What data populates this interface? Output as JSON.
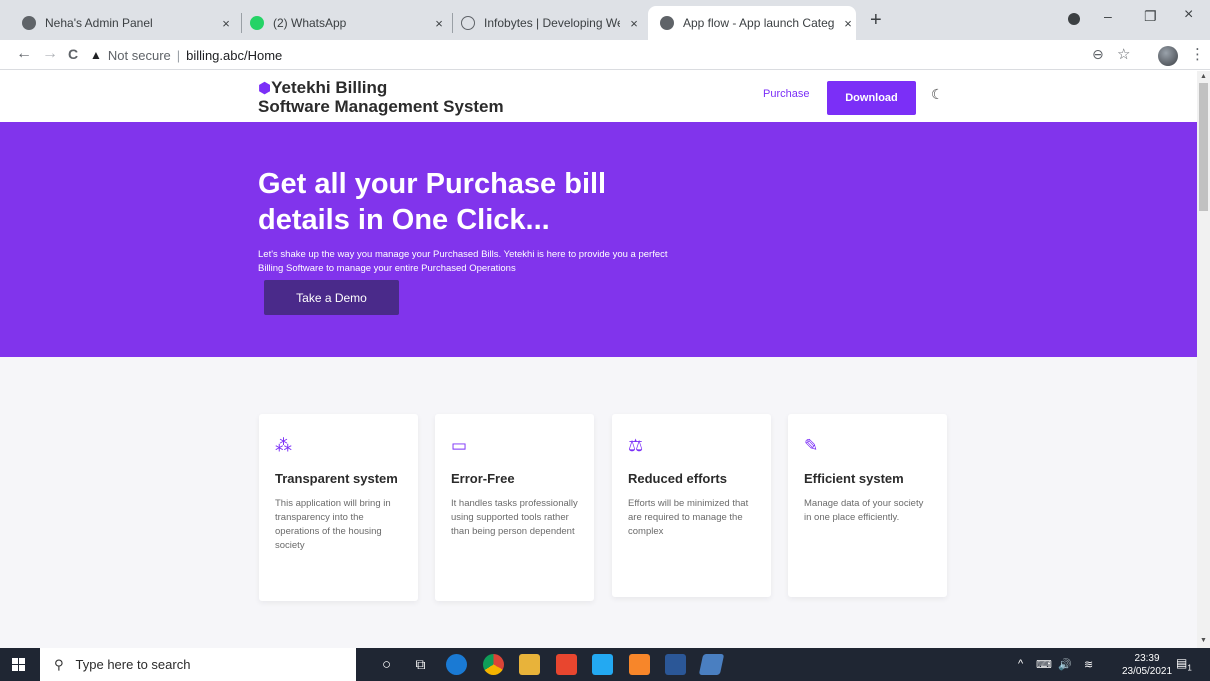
{
  "browser": {
    "tabs": [
      {
        "title": "Neha's Admin Panel",
        "close": "×"
      },
      {
        "title": "(2) WhatsApp",
        "close": "×"
      },
      {
        "title": "Infobytes | Developing Websites",
        "close": "×"
      },
      {
        "title": "App flow - App launch Category",
        "close": "×"
      }
    ],
    "new_tab": "+",
    "window": {
      "minimize": "–",
      "restore": "❐",
      "close": "×"
    },
    "nav": {
      "back": "←",
      "forward": "→",
      "reload": "C"
    },
    "address": {
      "warning_icon": "▲",
      "security": "Not secure",
      "divider": "|",
      "url": "billing.abc/Home"
    },
    "icons": {
      "zoom": "⊖",
      "star": "☆",
      "menu": "⋮"
    }
  },
  "site": {
    "brand_line1": "Yetekhi Billing",
    "brand_line2": "Software Management System",
    "brand_icon": "⬢",
    "nav_link": "Purchase",
    "download": "Download",
    "theme_icon": "☾",
    "accent": "#7b2ff7"
  },
  "hero": {
    "title": "Get all your Purchase bill details in One Click...",
    "text": "Let's shake up the way you manage your Purchased Bills. Yetekhi is here to provide you a perfect Billing Software to manage your entire Purchased Operations",
    "cta": "Take a Demo",
    "background": "#8134ec"
  },
  "features": [
    {
      "icon": "cubes-icon",
      "glyph": "⁂",
      "title": "Transparent system",
      "text": "This application will bring in transparency into the operations of the housing society"
    },
    {
      "icon": "laptop-icon",
      "glyph": "▭",
      "title": "Error-Free",
      "text": "It handles tasks professionally using supported tools rather than being person dependent"
    },
    {
      "icon": "balance-scale-icon",
      "glyph": "⚖",
      "title": "Reduced efforts",
      "text": "Efforts will be minimized that are required to manage the complex"
    },
    {
      "icon": "edit-icon",
      "glyph": "✎",
      "title": "Efficient system",
      "text": "Manage data of your society in one place efficiently."
    }
  ],
  "taskbar": {
    "search_placeholder": "Type here to search",
    "search_icon": "⚲",
    "cortana": "○",
    "task_view": "⧉",
    "tray": {
      "chevron": "^",
      "network": "⌨",
      "volume": "🔊",
      "wifi": "≋"
    },
    "time": "23:39",
    "date": "23/05/2021",
    "notification_count": "1"
  }
}
